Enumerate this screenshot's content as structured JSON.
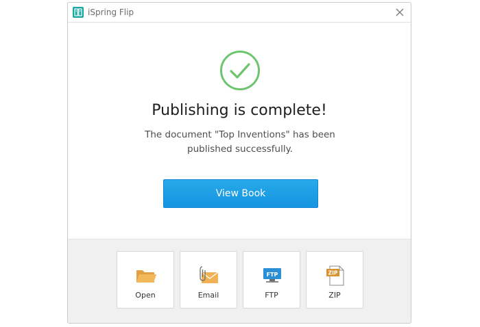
{
  "window": {
    "title": "iSpring Flip"
  },
  "colors": {
    "accent": "#1a9be6",
    "success": "#6cc46f",
    "folder": "#f0b253",
    "ftp_blue": "#2b8fd6",
    "zip_orange": "#d8922f"
  },
  "main": {
    "headline": "Publishing is complete!",
    "message": "The document \"Top Inventions\" has been published successfully.",
    "primary_button": "View Book"
  },
  "actions": [
    {
      "label": "Open",
      "icon": "folder-icon"
    },
    {
      "label": "Email",
      "icon": "email-icon"
    },
    {
      "label": "FTP",
      "icon": "ftp-icon",
      "badge": "FTP"
    },
    {
      "label": "ZIP",
      "icon": "zip-icon",
      "badge": "ZIP"
    }
  ]
}
